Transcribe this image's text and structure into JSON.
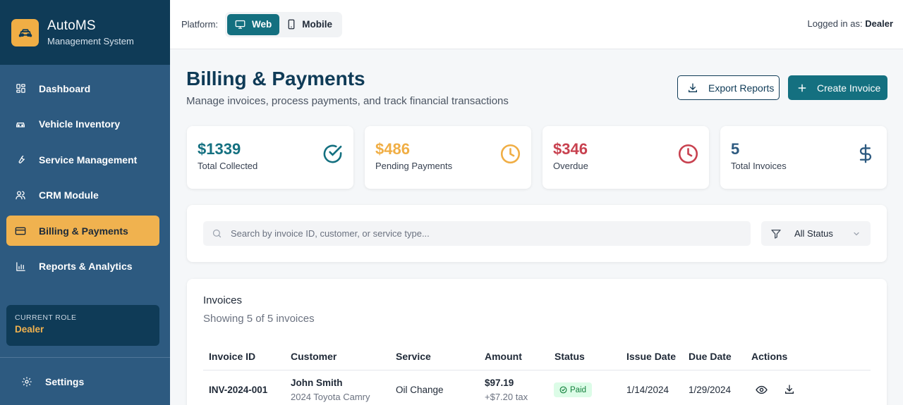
{
  "app": {
    "name": "AutoMS",
    "subtitle": "Management System"
  },
  "sidebar": {
    "items": [
      {
        "label": "Dashboard",
        "icon": "grid-icon",
        "active": false
      },
      {
        "label": "Vehicle Inventory",
        "icon": "car-icon",
        "active": false
      },
      {
        "label": "Service Management",
        "icon": "wrench-icon",
        "active": false
      },
      {
        "label": "CRM Module",
        "icon": "users-icon",
        "active": false
      },
      {
        "label": "Billing & Payments",
        "icon": "credit-card-icon",
        "active": true
      },
      {
        "label": "Reports & Analytics",
        "icon": "bar-chart-icon",
        "active": false
      }
    ],
    "role_label": "CURRENT ROLE",
    "role_value": "Dealer",
    "settings_label": "Settings"
  },
  "topbar": {
    "platform_label": "Platform:",
    "platform_options": [
      "Web",
      "Mobile"
    ],
    "platform_selected": "Web",
    "logged_prefix": "Logged in as:",
    "logged_user": "Dealer"
  },
  "header": {
    "title": "Billing & Payments",
    "subtitle": "Manage invoices, process payments, and track financial transactions",
    "export_label": "Export Reports",
    "create_label": "Create Invoice"
  },
  "stats": [
    {
      "value": "$1339",
      "label": "Total Collected",
      "color": "#147080",
      "icon": "check-circle-icon"
    },
    {
      "value": "$486",
      "label": "Pending Payments",
      "color": "#f0ae45",
      "icon": "clock-icon"
    },
    {
      "value": "$346",
      "label": "Overdue",
      "color": "#c8414f",
      "icon": "clock-icon"
    },
    {
      "value": "5",
      "label": "Total Invoices",
      "color": "#2d5a80",
      "icon": "dollar-icon"
    }
  ],
  "search": {
    "placeholder": "Search by invoice ID, customer, or service type...",
    "value": "",
    "status_filter": "All Status"
  },
  "invoices": {
    "title": "Invoices",
    "count_text": "Showing 5 of 5 invoices",
    "columns": [
      "Invoice ID",
      "Customer",
      "Service",
      "Amount",
      "Status",
      "Issue Date",
      "Due Date",
      "Actions"
    ],
    "rows": [
      {
        "id": "INV-2024-001",
        "customer": "John Smith",
        "vehicle": "2024 Toyota Camry",
        "service": "Oil Change",
        "amount": "$97.19",
        "tax": "+$7.20 tax",
        "status": "Paid",
        "issue_date": "1/14/2024",
        "due_date": "1/29/2024"
      }
    ]
  },
  "colors": {
    "sidebar_bg": "#2d5a80",
    "brand_bg": "#0f3b57",
    "accent": "#f0b24f",
    "primary": "#147080",
    "paid_bg": "#dcfce7",
    "paid_fg": "#15803d"
  }
}
